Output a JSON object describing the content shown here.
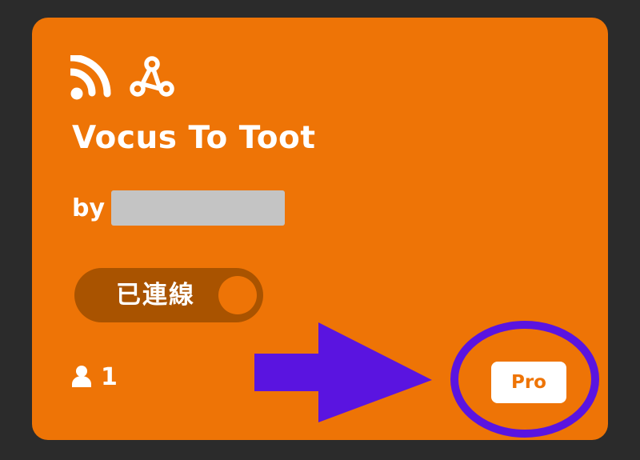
{
  "applet": {
    "service_icons": [
      "rss-icon",
      "webhook-icon"
    ],
    "title": "Vocus To Toot",
    "author_prefix": "by",
    "author_name_redacted": true,
    "connection_toggle": {
      "label": "已連線",
      "state": "on"
    },
    "user_count": "1",
    "badge": "Pro"
  },
  "colors": {
    "background": "#2b2b2b",
    "card": "#ee7406",
    "toggle_track": "#a95300",
    "redaction": "#c4c4c4",
    "annotation": "#5a14e0"
  },
  "annotation": {
    "arrow_direction": "right",
    "circled_element": "pro-badge"
  }
}
